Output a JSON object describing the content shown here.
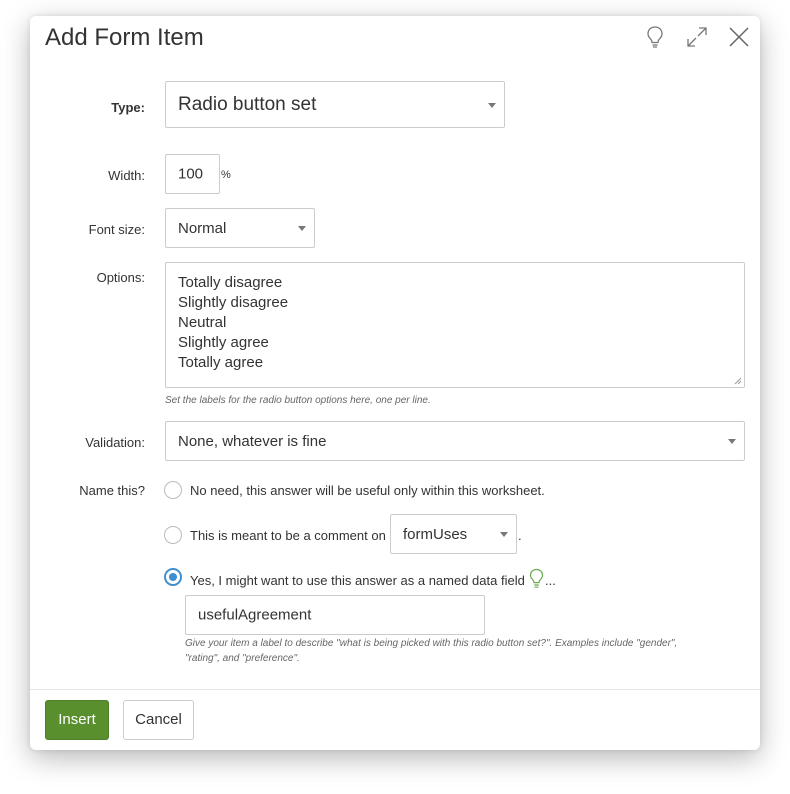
{
  "dialog": {
    "title": "Add Form Item",
    "icons": [
      "lightbulb-icon",
      "expand-icon",
      "close-icon"
    ]
  },
  "form": {
    "type": {
      "label": "Type:",
      "value": "Radio button set"
    },
    "width": {
      "label": "Width:",
      "value": "100",
      "unit": "%"
    },
    "font_size": {
      "label": "Font size:",
      "value": "Normal"
    },
    "options": {
      "label": "Options:",
      "lines": [
        "Totally disagree",
        "Slightly disagree",
        "Neutral",
        "Slightly agree",
        "Totally agree"
      ],
      "help": "Set the labels for the radio button options here, one per line."
    },
    "validation": {
      "label": "Validation:",
      "value": "None, whatever is fine"
    },
    "name_this": {
      "label": "Name this?",
      "choices": [
        {
          "text": "No need, this answer will be useful only within this worksheet.",
          "checked": false
        },
        {
          "text": "This is meant to be a comment on",
          "select_value": "formUses",
          "suffix": ".",
          "checked": false
        },
        {
          "text": "Yes, I might want to use this answer as a named data field",
          "suffix": "...",
          "checked": true
        }
      ],
      "field_value": "usefulAgreement",
      "help_line1": "Give your item a label to describe \"what is being picked with this radio button set?\". Examples include \"gender\",",
      "help_line2": "\"rating\", and \"preference\"."
    }
  },
  "footer": {
    "insert_label": "Insert",
    "cancel_label": "Cancel"
  },
  "colors": {
    "primary": "#5a8f2e",
    "radio_checked": "#3d8fd1",
    "hint_icon": "#6aa84f"
  }
}
